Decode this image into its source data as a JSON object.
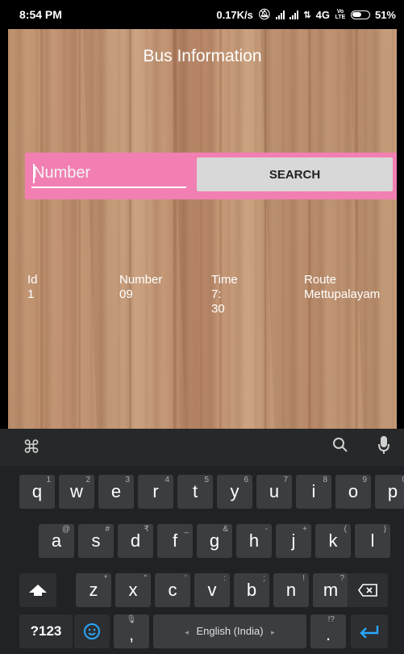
{
  "status": {
    "time": "8:54 PM",
    "speed": "0.17K/s",
    "network": "4G",
    "volte": "Vo LTE",
    "battery": "51%"
  },
  "app": {
    "title": "Bus Information",
    "search": {
      "placeholder": "Number",
      "button_label": "SEARCH"
    },
    "table": {
      "headers": [
        "Id",
        "Number",
        "Time",
        "Route"
      ],
      "rows": [
        [
          "1",
          "09",
          "7: 30",
          "Mettupalayam"
        ]
      ]
    }
  },
  "keyboard": {
    "icons": [
      "apps-icon",
      "search-icon",
      "mic-icon"
    ],
    "row1": [
      {
        "key": "q",
        "sup": "1"
      },
      {
        "key": "w",
        "sup": "2"
      },
      {
        "key": "e",
        "sup": "3"
      },
      {
        "key": "r",
        "sup": "4"
      },
      {
        "key": "t",
        "sup": "5"
      },
      {
        "key": "y",
        "sup": "6"
      },
      {
        "key": "u",
        "sup": "7"
      },
      {
        "key": "i",
        "sup": "8"
      },
      {
        "key": "o",
        "sup": "9"
      },
      {
        "key": "p",
        "sup": "0"
      }
    ],
    "row2": [
      {
        "key": "a",
        "sup": "@"
      },
      {
        "key": "s",
        "sup": "#"
      },
      {
        "key": "d",
        "sup": "₹"
      },
      {
        "key": "f",
        "sup": "_"
      },
      {
        "key": "g",
        "sup": "&"
      },
      {
        "key": "h",
        "sup": "-"
      },
      {
        "key": "j",
        "sup": "+"
      },
      {
        "key": "k",
        "sup": "("
      },
      {
        "key": "l",
        "sup": ")"
      }
    ],
    "row3": [
      {
        "key": "z",
        "sup": "*"
      },
      {
        "key": "x",
        "sup": "\""
      },
      {
        "key": "c",
        "sup": "'"
      },
      {
        "key": "v",
        "sup": ":"
      },
      {
        "key": "b",
        "sup": ";"
      },
      {
        "key": "n",
        "sup": "!"
      },
      {
        "key": "m",
        "sup": "?"
      }
    ],
    "symbols_label": "?123",
    "comma_label": ",",
    "space_label": "English (India)",
    "period_label": ".",
    "period_sup": "!?"
  }
}
